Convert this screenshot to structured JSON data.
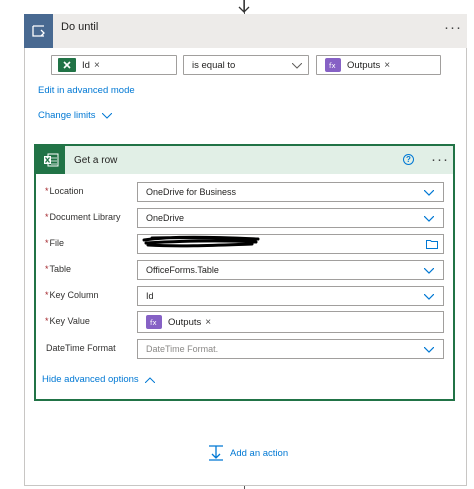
{
  "do_until": {
    "title": "Do until",
    "more_icon": "more-dots-icon",
    "condition": {
      "left_token": "Id",
      "left_icon": "excel-icon",
      "operator": "is equal to",
      "right_token": "Outputs",
      "right_icon": "expression-icon"
    },
    "advanced_link": "Edit in advanced mode",
    "limits_link": "Change limits"
  },
  "get_row": {
    "title": "Get a row",
    "help_icon": "help-circle-icon",
    "fields": [
      {
        "label": "Location",
        "required": "*",
        "value": "OneDrive for Business"
      },
      {
        "label": "Document Library",
        "required": "*",
        "value": "OneDrive"
      },
      {
        "label": "File",
        "required": "*",
        "value": ""
      },
      {
        "label": "Table",
        "required": "*",
        "value": "OfficeForms.Table"
      },
      {
        "label": "Key Column",
        "required": "*",
        "value": "Id"
      },
      {
        "label": "Key Value",
        "required": "*",
        "value": "Outputs"
      },
      {
        "label": "DateTime Format",
        "required": "",
        "placeholder": "DateTime Format."
      }
    ],
    "hide_advanced": "Hide advanced options"
  },
  "add_action": "Add an action",
  "colors": {
    "do_until_accent": "#486991",
    "excel_green": "#217346",
    "link_blue": "#0078d4",
    "expression_purple": "#8661c5"
  }
}
